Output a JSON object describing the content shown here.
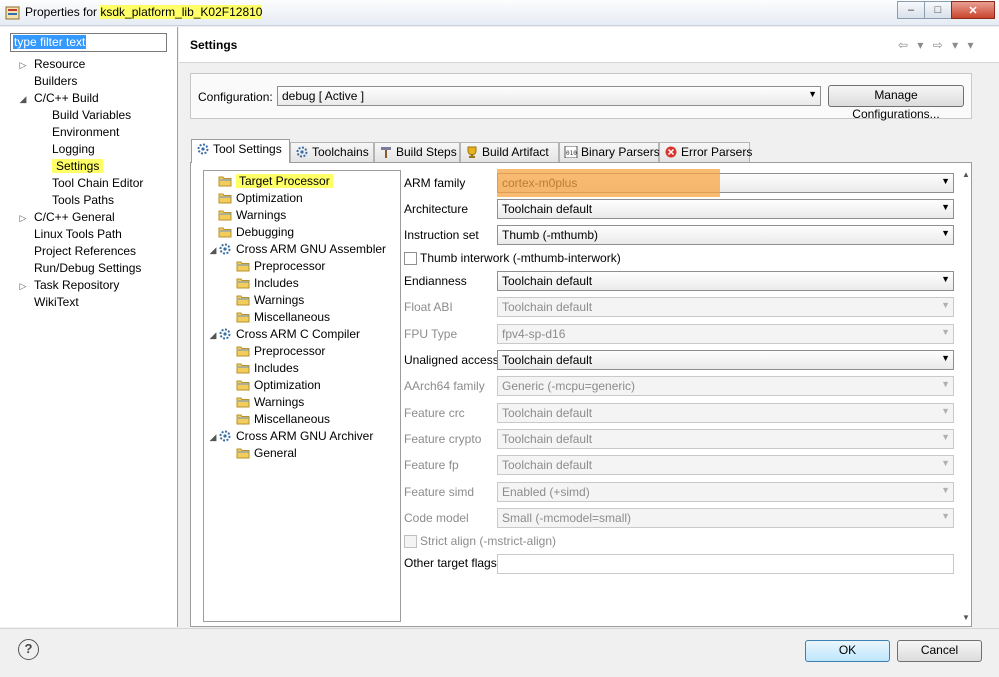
{
  "window": {
    "title_prefix": "Properties for ",
    "title_project": "ksdk_platform_lib_K02F12810",
    "minimize": "–",
    "maximize": "□",
    "close": "✕"
  },
  "left": {
    "filter_placeholder": "type filter text",
    "tree": [
      {
        "label": "Resource",
        "indent": 0,
        "twisty": "▷"
      },
      {
        "label": "Builders",
        "indent": 0,
        "twisty": ""
      },
      {
        "label": "C/C++ Build",
        "indent": 0,
        "twisty": "◢"
      },
      {
        "label": "Build Variables",
        "indent": 1,
        "twisty": ""
      },
      {
        "label": "Environment",
        "indent": 1,
        "twisty": ""
      },
      {
        "label": "Logging",
        "indent": 1,
        "twisty": ""
      },
      {
        "label": "Settings",
        "indent": 1,
        "twisty": "",
        "highlight": true
      },
      {
        "label": "Tool Chain Editor",
        "indent": 1,
        "twisty": ""
      },
      {
        "label": "Tools Paths",
        "indent": 1,
        "twisty": ""
      },
      {
        "label": "C/C++ General",
        "indent": 0,
        "twisty": "▷"
      },
      {
        "label": "Linux Tools Path",
        "indent": 0,
        "twisty": ""
      },
      {
        "label": "Project References",
        "indent": 0,
        "twisty": ""
      },
      {
        "label": "Run/Debug Settings",
        "indent": 0,
        "twisty": ""
      },
      {
        "label": "Task Repository",
        "indent": 0,
        "twisty": "▷"
      },
      {
        "label": "WikiText",
        "indent": 0,
        "twisty": ""
      }
    ]
  },
  "header": {
    "title": "Settings",
    "nav": "⇦ ▾ ⇨ ▾ ▾"
  },
  "config": {
    "label": "Configuration:",
    "value": "debug  [ Active ]",
    "manage_label": "Manage Configurations..."
  },
  "tabs": [
    {
      "label": "Tool Settings",
      "active": true
    },
    {
      "label": "Toolchains"
    },
    {
      "label": "Build Steps"
    },
    {
      "label": "Build Artifact"
    },
    {
      "label": "Binary Parsers"
    },
    {
      "label": "Error Parsers"
    }
  ],
  "tool_tree": [
    {
      "label": "Target Processor",
      "level": 0,
      "twisty": "",
      "highlight": true
    },
    {
      "label": "Optimization",
      "level": 0,
      "twisty": ""
    },
    {
      "label": "Warnings",
      "level": 0,
      "twisty": ""
    },
    {
      "label": "Debugging",
      "level": 0,
      "twisty": ""
    },
    {
      "label": "Cross ARM GNU Assembler",
      "level": 0,
      "twisty": "◢",
      "tool": true
    },
    {
      "label": "Preprocessor",
      "level": 1,
      "twisty": ""
    },
    {
      "label": "Includes",
      "level": 1,
      "twisty": ""
    },
    {
      "label": "Warnings",
      "level": 1,
      "twisty": ""
    },
    {
      "label": "Miscellaneous",
      "level": 1,
      "twisty": ""
    },
    {
      "label": "Cross ARM C Compiler",
      "level": 0,
      "twisty": "◢",
      "tool": true
    },
    {
      "label": "Preprocessor",
      "level": 1,
      "twisty": ""
    },
    {
      "label": "Includes",
      "level": 1,
      "twisty": ""
    },
    {
      "label": "Optimization",
      "level": 1,
      "twisty": ""
    },
    {
      "label": "Warnings",
      "level": 1,
      "twisty": ""
    },
    {
      "label": "Miscellaneous",
      "level": 1,
      "twisty": ""
    },
    {
      "label": "Cross ARM GNU Archiver",
      "level": 0,
      "twisty": "◢",
      "tool": true
    },
    {
      "label": "General",
      "level": 1,
      "twisty": ""
    }
  ],
  "props": {
    "arm_family": {
      "label": "ARM family",
      "value": "cortex-m0plus"
    },
    "architecture": {
      "label": "Architecture",
      "value": "Toolchain default"
    },
    "instruction_set": {
      "label": "Instruction set",
      "value": "Thumb (-mthumb)"
    },
    "thumb_interwork": {
      "label": "Thumb interwork (-mthumb-interwork)"
    },
    "endianness": {
      "label": "Endianness",
      "value": "Toolchain default"
    },
    "float_abi": {
      "label": "Float ABI",
      "value": "Toolchain default"
    },
    "fpu_type": {
      "label": "FPU Type",
      "value": "fpv4-sp-d16"
    },
    "unaligned": {
      "label": "Unaligned access",
      "value": "Toolchain default"
    },
    "aarch64": {
      "label": "AArch64 family",
      "value": "Generic (-mcpu=generic)"
    },
    "feature_crc": {
      "label": "Feature crc",
      "value": "Toolchain default"
    },
    "feature_crypto": {
      "label": "Feature crypto",
      "value": "Toolchain default"
    },
    "feature_fp": {
      "label": "Feature fp",
      "value": "Toolchain default"
    },
    "feature_simd": {
      "label": "Feature simd",
      "value": "Enabled (+simd)"
    },
    "code_model": {
      "label": "Code model",
      "value": "Small (-mcmodel=small)"
    },
    "strict_align": {
      "label": "Strict align (-mstrict-align)"
    },
    "other_flags": {
      "label": "Other target flags",
      "value": ""
    }
  },
  "footer": {
    "help": "?",
    "ok": "OK",
    "cancel": "Cancel"
  },
  "colors": {
    "highlight_yellow": "#ffff66",
    "highlight_orange": "#f5a442"
  }
}
